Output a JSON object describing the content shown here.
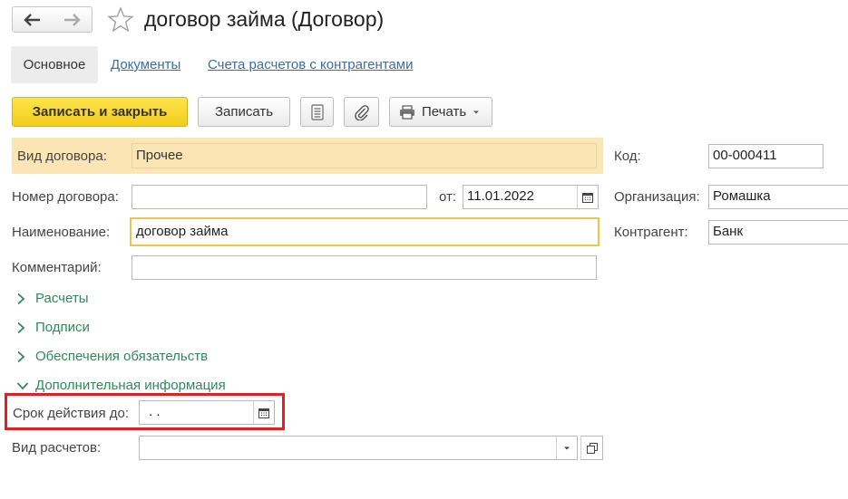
{
  "window": {
    "title": "договор займа (Договор)"
  },
  "nav": {
    "back_icon": "arrow-left-icon",
    "forward_icon": "arrow-right-icon",
    "favorite_icon": "star-icon"
  },
  "tabs": [
    {
      "label": "Основное",
      "active": true
    },
    {
      "label": "Документы",
      "active": false
    },
    {
      "label": "Счета расчетов с контрагентами",
      "active": false
    }
  ],
  "toolbar": {
    "save_close_label": "Записать и закрыть",
    "save_label": "Записать",
    "list_icon": "list-icon",
    "attach_icon": "paperclip-icon",
    "print_label": "Печать",
    "print_icon": "printer-icon"
  },
  "form": {
    "contract_type": {
      "label": "Вид договора:",
      "value": "Прочее"
    },
    "number": {
      "label": "Номер договора:",
      "value": ""
    },
    "date": {
      "label": "от:",
      "value": "11.01.2022"
    },
    "name": {
      "label": "Наименование:",
      "value": "договор займа"
    },
    "comment": {
      "label": "Комментарий:",
      "value": ""
    },
    "code": {
      "label": "Код:",
      "value": "00-000411"
    },
    "organization": {
      "label": "Организация:",
      "value": "Ромашка"
    },
    "counterparty": {
      "label": "Контрагент:",
      "value": "Банк"
    },
    "groups": [
      {
        "label": "Расчеты",
        "expanded": false
      },
      {
        "label": "Подписи",
        "expanded": false
      },
      {
        "label": "Обеспечения обязательств",
        "expanded": false
      },
      {
        "label": "Дополнительная информация",
        "expanded": true
      }
    ],
    "valid_until": {
      "label": "Срок действия до:",
      "value": " .  ."
    },
    "settlement_type": {
      "label": "Вид расчетов:",
      "value": ""
    }
  },
  "colors": {
    "accent_yellow": "#f4cc1a",
    "highlight_red": "#e31e24",
    "group_green": "#2e8b57",
    "link_blue": "#3a6ea5",
    "focus_border": "#f0c34a"
  }
}
